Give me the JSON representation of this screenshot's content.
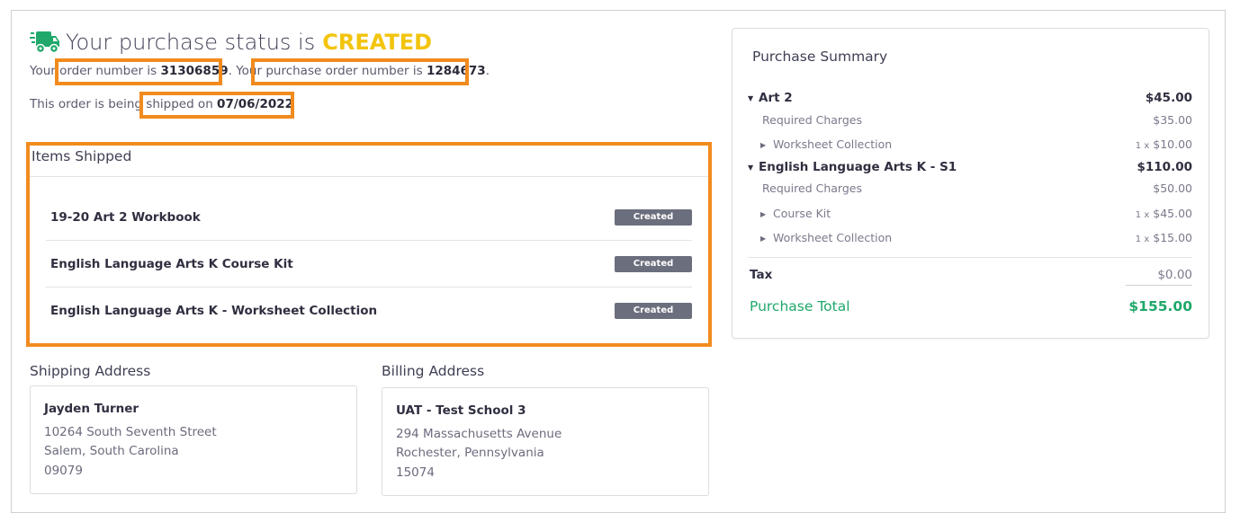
{
  "header": {
    "status_prefix": "Your purchase status is",
    "status_value": "CREATED",
    "order_prefix": "Your order number is",
    "order_number": "31306859",
    "po_prefix": ". Your purchase order number is",
    "po_number": "1284673",
    "po_suffix": ".",
    "ship_prefix": "This order is being shipped on",
    "ship_date": "07/06/2022"
  },
  "items_shipped": {
    "title": "Items Shipped",
    "items": [
      {
        "name": "19-20 Art 2 Workbook",
        "status": "Created"
      },
      {
        "name": "English Language Arts K Course Kit",
        "status": "Created"
      },
      {
        "name": "English Language Arts K - Worksheet Collection",
        "status": "Created"
      }
    ]
  },
  "shipping_address": {
    "title": "Shipping Address",
    "name": "Jayden Turner",
    "street": "10264 South Seventh Street",
    "city_state": "Salem, South Carolina",
    "zip": "09079"
  },
  "billing_address": {
    "title": "Billing Address",
    "name": "UAT - Test School 3",
    "street": "294 Massachusetts Avenue",
    "city_state": "Rochester, Pennsylvania",
    "zip": "15074"
  },
  "summary": {
    "title": "Purchase Summary",
    "groups": [
      {
        "name": "Art 2",
        "amount": "$45.00",
        "required_label": "Required Charges",
        "required_amount": "$35.00",
        "lines": [
          {
            "name": "Worksheet Collection",
            "qty": "1 x",
            "price": "$10.00"
          }
        ]
      },
      {
        "name": "English Language Arts K - S1",
        "amount": "$110.00",
        "required_label": "Required Charges",
        "required_amount": "$50.00",
        "lines": [
          {
            "name": "Course Kit",
            "qty": "1 x",
            "price": "$45.00"
          },
          {
            "name": "Worksheet Collection",
            "qty": "1 x",
            "price": "$15.00"
          }
        ]
      }
    ],
    "tax_label": "Tax",
    "tax_amount": "$0.00",
    "total_label": "Purchase Total",
    "total_amount": "$155.00"
  },
  "colors": {
    "status_accent": "#f2c40c",
    "truck_icon": "#1fa86a",
    "total_accent": "#1fa86a",
    "highlight_border": "#f28b1e",
    "badge_bg": "#6b6e7d"
  }
}
